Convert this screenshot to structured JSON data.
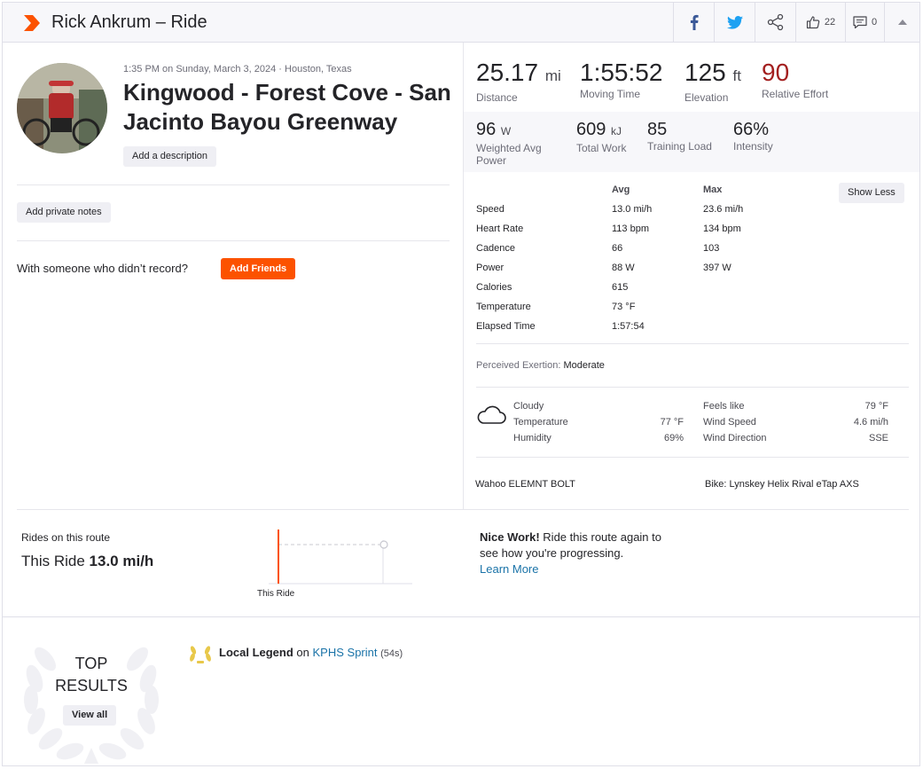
{
  "header": {
    "title": "Rick Ankrum – Ride",
    "kudos_count": "22",
    "comments_count": "0",
    "brand_color": "#fc5200"
  },
  "activity": {
    "meta": "1:35 PM on Sunday, March 3, 2024 · Houston, Texas",
    "name": "Kingwood - Forest Cove - San Jacinto Bayou Greenway",
    "add_description_label": "Add a description",
    "add_private_notes_label": "Add private notes",
    "with_someone_text": "With someone who didn’t record?",
    "add_friends_label": "Add Friends"
  },
  "primary_stats": [
    {
      "value": "25.17",
      "unit": "mi",
      "label": "Distance"
    },
    {
      "value": "1:55:52",
      "unit": "",
      "label": "Moving Time"
    },
    {
      "value": "125",
      "unit": "ft",
      "label": "Elevation"
    },
    {
      "value": "90",
      "unit": "",
      "label": "Relative Effort"
    }
  ],
  "secondary_stats": [
    {
      "value": "96",
      "unit": "W",
      "label": "Weighted Avg Power"
    },
    {
      "value": "609",
      "unit": "kJ",
      "label": "Total Work"
    },
    {
      "value": "85",
      "unit": "",
      "label": "Training Load"
    },
    {
      "value": "66%",
      "unit": "",
      "label": "Intensity"
    }
  ],
  "details": {
    "avg_header": "Avg",
    "max_header": "Max",
    "show_less_label": "Show Less",
    "rows": [
      {
        "label": "Speed",
        "avg": "13.0 mi/h",
        "max": "23.6 mi/h"
      },
      {
        "label": "Heart Rate",
        "avg": "113 bpm",
        "max": "134 bpm"
      },
      {
        "label": "Cadence",
        "avg": "66",
        "max": "103"
      },
      {
        "label": "Power",
        "avg": "88 W",
        "max": "397 W"
      },
      {
        "label": "Calories",
        "avg": "615",
        "max": ""
      },
      {
        "label": "Temperature",
        "avg": "73 °F",
        "max": ""
      },
      {
        "label": "Elapsed Time",
        "avg": "1:57:54",
        "max": ""
      }
    ]
  },
  "exertion": {
    "label": "Perceived Exertion:",
    "value": "Moderate"
  },
  "weather": {
    "condition": "Cloudy",
    "temperature_label": "Temperature",
    "temperature_value": "77 °F",
    "humidity_label": "Humidity",
    "humidity_value": "69%",
    "feels_like_label": "Feels like",
    "feels_like_value": "79 °F",
    "wind_speed_label": "Wind Speed",
    "wind_speed_value": "4.6 mi/h",
    "wind_direction_label": "Wind Direction",
    "wind_direction_value": "SSE"
  },
  "devices": {
    "device": "Wahoo ELEMNT BOLT",
    "bike": "Bike: Lynskey Helix Rival eTap AXS"
  },
  "route": {
    "label": "Rides on this route",
    "this_ride_prefix": "This Ride",
    "this_ride_value": "13.0 mi/h",
    "chart_label": "This Ride",
    "nice_bold": "Nice Work!",
    "nice_text": "Ride this route again to see how you're progressing.",
    "learn_more": "Learn More"
  },
  "top_results": {
    "title_line1": "TOP",
    "title_line2": "RESULTS",
    "view_all_label": "View all",
    "legend_bold": "Local Legend",
    "legend_on": "on",
    "segment_name": "KPHS Sprint",
    "segment_time": "(54s)"
  }
}
